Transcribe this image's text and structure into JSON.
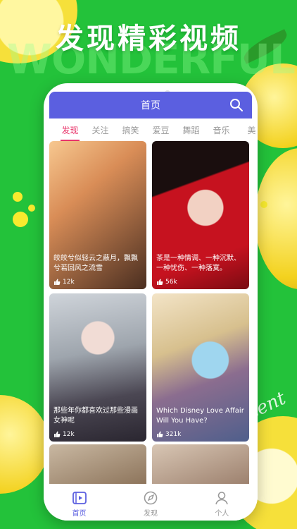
{
  "headline": "发现精彩视频",
  "background_word": "WONDERFUL",
  "script_text": "Wonderful content",
  "colors": {
    "brand": "#5b5fe0",
    "accent": "#e8346a",
    "background": "#23c23a"
  },
  "app": {
    "title": "首页",
    "search_icon": "search-icon",
    "tabs": [
      {
        "label": "发现",
        "active": true
      },
      {
        "label": "关注"
      },
      {
        "label": "搞笑"
      },
      {
        "label": "爱豆"
      },
      {
        "label": "舞蹈"
      },
      {
        "label": "音乐"
      },
      {
        "label": "美"
      }
    ],
    "cards": [
      {
        "caption": "皎皎兮似轻云之蔽月，飘飘兮若回风之流雪",
        "likes": "12k"
      },
      {
        "caption": "茶是一种情调、一种沉默、一种忧伤、一种落寞。",
        "likes": "56k"
      },
      {
        "caption": "那些年你都喜欢过那些漫画女神呢",
        "likes": "12k"
      },
      {
        "caption": "Which Disney Love Affair Will You Have?",
        "likes": "321k"
      }
    ],
    "nav": [
      {
        "label": "首页",
        "icon": "video-icon",
        "active": true
      },
      {
        "label": "发现",
        "icon": "compass-icon"
      },
      {
        "label": "个人",
        "icon": "user-icon"
      }
    ]
  }
}
